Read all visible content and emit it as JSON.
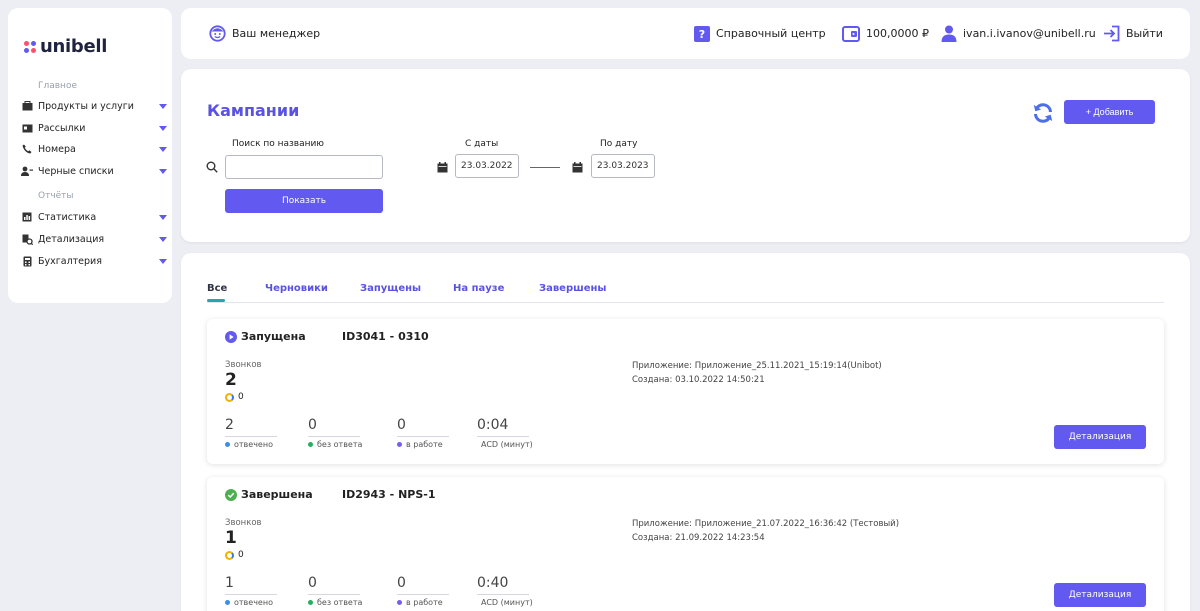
{
  "colors": {
    "accent": "#6259f0",
    "title": "#5a52e0",
    "teal": "#27a4b0"
  },
  "logo": {
    "text": "unibell"
  },
  "sidebar": {
    "section_main": "Главное",
    "section_reports": "Отчёты",
    "items_main": [
      {
        "label": "Продукты и услуги",
        "icon": "box-icon"
      },
      {
        "label": "Рассылки",
        "icon": "mail-icon"
      },
      {
        "label": "Номера",
        "icon": "phone-icon"
      },
      {
        "label": "Черные списки",
        "icon": "user-block-icon"
      }
    ],
    "items_reports": [
      {
        "label": "Статистика",
        "icon": "chart-icon"
      },
      {
        "label": "Детализация",
        "icon": "detail-icon"
      },
      {
        "label": "Бухгалтерия",
        "icon": "calculator-icon"
      }
    ]
  },
  "topbar": {
    "manager": "Ваш менеджер",
    "help": "Справочный центр",
    "balance": "100,0000 ₽",
    "email": "ivan.i.ivanov@unibell.ru",
    "logout": "Выйти"
  },
  "filters": {
    "title": "Кампании",
    "add_label": "+ Добавить",
    "search_label": "Поиск по названию",
    "search_value": "",
    "show_label": "Показать",
    "from_label": "С даты",
    "from_value": "23.03.2022",
    "to_label": "По дату",
    "to_value": "23.03.2023"
  },
  "tabs": [
    {
      "label": "Все",
      "active": true
    },
    {
      "label": "Черновики",
      "active": false
    },
    {
      "label": "Запущены",
      "active": false
    },
    {
      "label": "На паузе",
      "active": false
    },
    {
      "label": "Завершены",
      "active": false
    }
  ],
  "campaigns": [
    {
      "status": "Запущена",
      "status_icon": "play-icon",
      "id": "ID3041 - 0310",
      "calls_label": "Звонков",
      "calls": "2",
      "sub_value": "0",
      "app": "Приложение: Приложение_25.11.2021_15:19:14(Unibot)",
      "created": "Создана: 03.10.2022 14:50:21",
      "stats": [
        {
          "value": "2",
          "label": "отвечено",
          "color": "#3a8ee6"
        },
        {
          "value": "0",
          "label": "без ответа",
          "color": "#27ae60"
        },
        {
          "value": "0",
          "label": "в работе",
          "color": "#7a5cf0"
        },
        {
          "value": "0:04",
          "label": "ACD (минут)",
          "color": "#333333"
        }
      ],
      "detail_label": "Детализация"
    },
    {
      "status": "Завершена",
      "status_icon": "check-circle-icon",
      "id": "ID2943 - NPS-1",
      "calls_label": "Звонков",
      "calls": "1",
      "sub_value": "0",
      "app": "Приложение: Приложение_21.07.2022_16:36:42 (Тестовый)",
      "created": "Создана: 21.09.2022 14:23:54",
      "stats": [
        {
          "value": "1",
          "label": "отвечено",
          "color": "#3a8ee6"
        },
        {
          "value": "0",
          "label": "без ответа",
          "color": "#27ae60"
        },
        {
          "value": "0",
          "label": "в работе",
          "color": "#7a5cf0"
        },
        {
          "value": "0:40",
          "label": "ACD (минут)",
          "color": "#333333"
        }
      ],
      "detail_label": "Детализация"
    }
  ]
}
